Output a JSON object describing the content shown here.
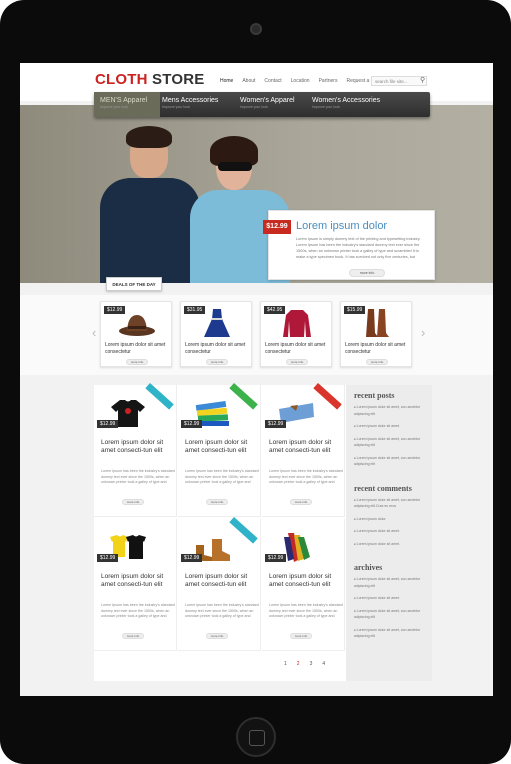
{
  "logo": {
    "part1": "CLOTH",
    "part2": "STORE"
  },
  "nav": [
    "Home",
    "About",
    "Contact",
    "Location",
    "Partners",
    "Request a Quote"
  ],
  "search": {
    "placeholder": "search file site..."
  },
  "categories": [
    {
      "title": "MEN'S Apparel",
      "sub": "Improve your look"
    },
    {
      "title": "Mens Accessories",
      "sub": "Improve your look"
    },
    {
      "title": "Women's Apparel",
      "sub": "Improve your look"
    },
    {
      "title": "Women's  Accessories",
      "sub": "Improve your look"
    }
  ],
  "promo": {
    "price": "$12.99",
    "title": "Lorem ipsum dolor",
    "text": "Lorem Ipsum is simply dummy text of the printing and typesetting industry. Lorem Ipsum has been the industry's standard dummy text ever since the 1500s, when an unknown printer took a galley of type and scrambled it to make a type specimen book. It has survived not only five centuries, but",
    "more": "more info"
  },
  "deals_label": "DEALS OF THE DAY",
  "deals": [
    {
      "price": "$12.99",
      "text": "Lorem ipsum dolor sit amet consectetur",
      "more": "more info"
    },
    {
      "price": "$31.95",
      "text": "Lorem ipsum dolor sit amet consectetur",
      "more": "more info"
    },
    {
      "price": "$42.95",
      "text": "Lorem ipsum dolor sit amet consectetur",
      "more": "more info"
    },
    {
      "price": "$15.99",
      "text": "Lorem ipsum dolor sit amet consectetur",
      "more": "more info"
    }
  ],
  "products": [
    {
      "price": "$12.99",
      "title": "Lorem ipsum dolor sit amet consecti-tun elit",
      "text": "Lorem Ipsum has been the industry's standard dummy text ever since the 1500s, when an unknown printer took a galley of type and",
      "more": "more info",
      "ribbon": "#2fb3c8"
    },
    {
      "price": "$12.99",
      "title": "Lorem ipsum dolor sit amet consecti-tun elit",
      "text": "Lorem Ipsum has been the industry's standard dummy text ever since the 1500s, when an unknown printer took a galley of type and",
      "more": "more info",
      "ribbon": "#3cb24a"
    },
    {
      "price": "$12.99",
      "title": "Lorem ipsum dolor sit amet consecti-tun elit",
      "text": "Lorem Ipsum has been the industry's standard dummy text ever since the 1500s, when an unknown printer took a galley of type and",
      "more": "more info",
      "ribbon": "#d9352c"
    },
    {
      "price": "$12.99",
      "title": "Lorem ipsum dolor sit amet consecti-tun elit",
      "text": "Lorem Ipsum has been the industry's standard dummy text ever since the 1500s, when an unknown printer took a galley of type and",
      "more": "more info",
      "ribbon": ""
    },
    {
      "price": "$12.99",
      "title": "Lorem ipsum dolor sit amet consecti-tun elit",
      "text": "Lorem Ipsum has been the industry's standard dummy text ever since the 1500s, when an unknown printer took a galley of type and",
      "more": "more info",
      "ribbon": "#2fb3c8"
    },
    {
      "price": "$12.99",
      "title": "Lorem ipsum dolor sit amet consecti-tun elit",
      "text": "Lorem Ipsum has been the industry's standard dummy text ever since the 1500s, when an unknown printer took a galley of type and",
      "more": "more info",
      "ribbon": ""
    }
  ],
  "pagination": [
    "1",
    "2",
    "3",
    "4"
  ],
  "sidebar": {
    "recent_posts": {
      "title": "recent posts",
      "items": [
        "Lorem ipsum dolor sit amet, con-sectetur adipiscing elit",
        "Lorem ipsum dolor sit amet.",
        "Lorem ipsum dolor sit amet, con-sectetur adipiscing elit",
        "Lorem ipsum dolor sit amet, con-sectetur adipiscing elit"
      ]
    },
    "recent_comments": {
      "title": "recent comments",
      "items": [
        "Lorem ipsum dolor sit amet, con-sectetur adipiscing elit.Cras eu eros",
        "Lorem ipsum dolor",
        "Lorem ipsum dolor sit amet.",
        "Lorem ipsum dolor sit amet."
      ]
    },
    "archives": {
      "title": "archives",
      "items": [
        "Lorem ipsum dolor sit amet, con-sectetur adipiscing elit",
        "Lorem ipsum dolor sit amet.",
        "Lorem ipsum dolor sit amet, con-sectetur adipiscing elit",
        "Lorem ipsum dolor sit amet, con-sectetur adipiscing elit"
      ]
    }
  }
}
